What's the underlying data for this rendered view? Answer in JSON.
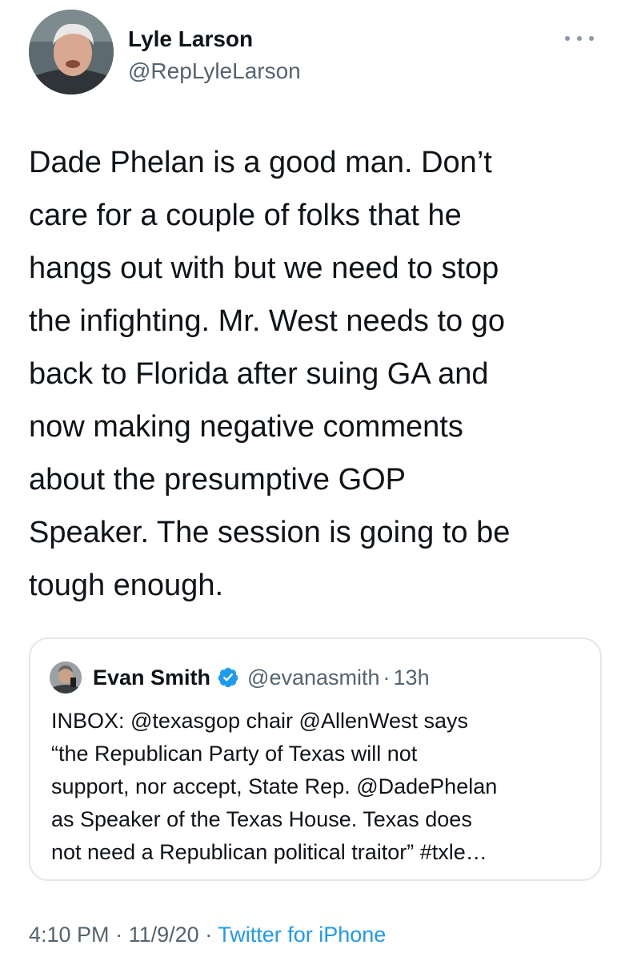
{
  "author": {
    "display_name": "Lyle Larson",
    "handle": "@RepLyleLarson"
  },
  "tweet": {
    "text": "Dade Phelan is a good man. Don’t\ncare for a couple of folks that he\nhangs out with but we need to stop\nthe infighting. Mr. West needs to go\nback to Florida after suing GA and\nnow making negative comments\nabout the presumptive GOP\nSpeaker. The session is going to be\ntough enough."
  },
  "quoted_tweet": {
    "display_name": "Evan Smith",
    "verified": true,
    "handle": "@evanasmith",
    "separator": "·",
    "time": "13h",
    "text": "INBOX: @texasgop chair @AllenWest says\n“the Republican Party of Texas will not\nsupport, nor accept, State Rep. @DadePhelan\nas Speaker of the Texas House. Texas does\nnot need a Republican political traitor” #txle…"
  },
  "meta": {
    "time": "4:10 PM",
    "separator": "·",
    "date": "11/9/20",
    "source": "Twitter for iPhone"
  },
  "icons": {
    "more": "more-horizontal-icon",
    "verified": "verified-badge-icon"
  },
  "colors": {
    "link_blue": "#1d9bf0",
    "secondary_text": "#536471",
    "border": "#e1e8ed"
  }
}
